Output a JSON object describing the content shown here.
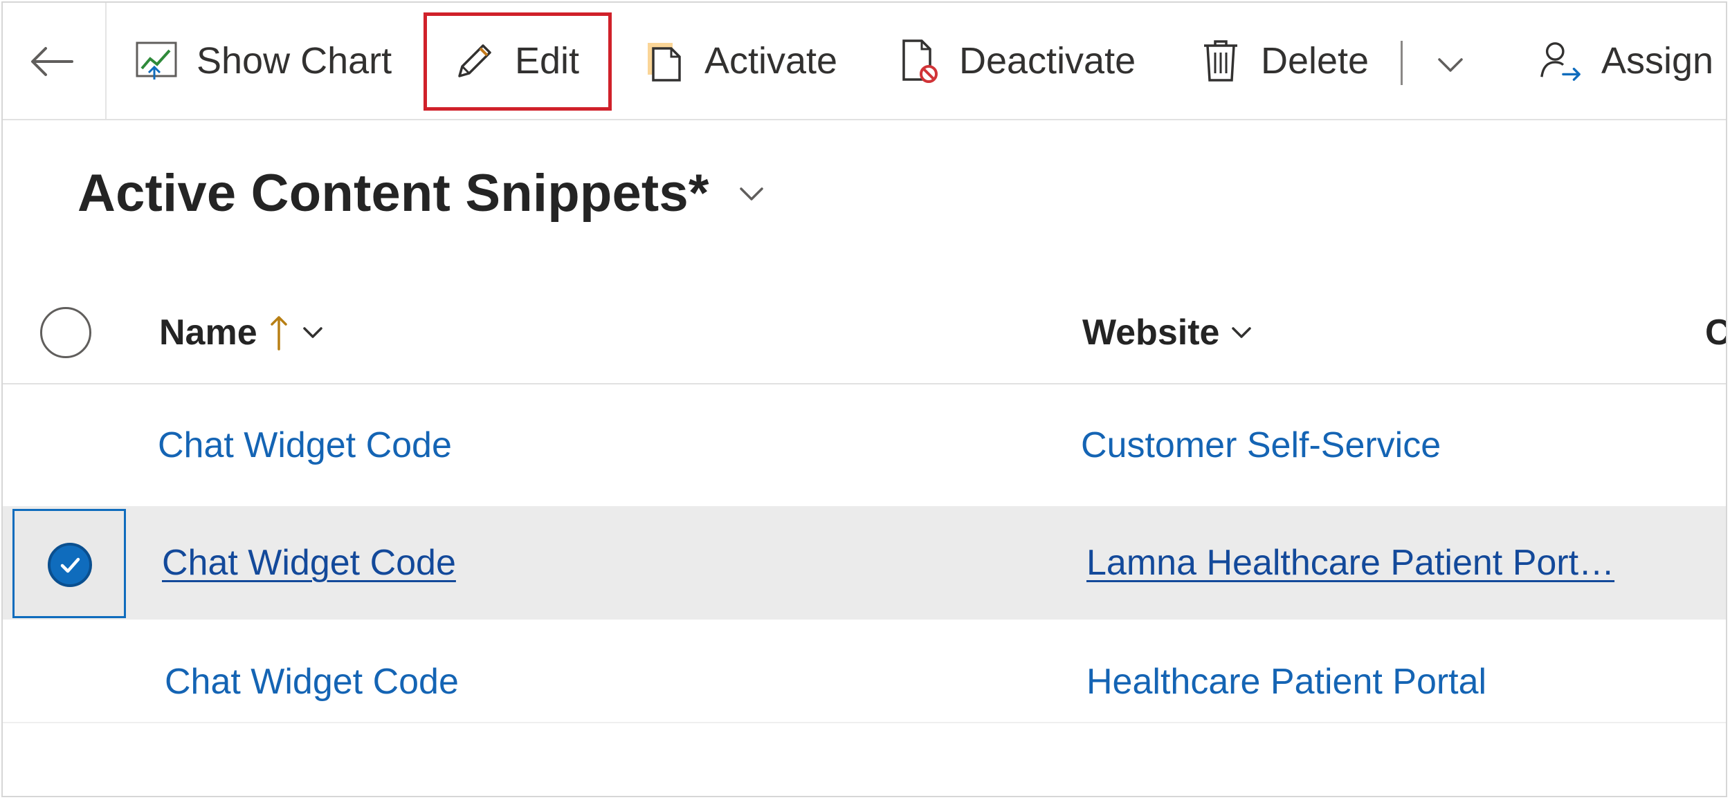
{
  "toolbar": {
    "show_chart": "Show Chart",
    "edit": "Edit",
    "activate": "Activate",
    "deactivate": "Deactivate",
    "delete": "Delete",
    "assign": "Assign",
    "icons": [
      "back-arrow-icon",
      "chart-icon",
      "pencil-icon",
      "activate-icon",
      "deactivate-icon",
      "trash-icon",
      "chevron-down-icon",
      "assign-user-icon"
    ]
  },
  "view": {
    "title": "Active Content Snippets*"
  },
  "grid": {
    "columns": [
      {
        "label": "Name",
        "sort": "ascending"
      },
      {
        "label": "Website"
      },
      {
        "label": "C"
      }
    ],
    "rows": [
      {
        "name": "Chat Widget Code",
        "website": "Customer Self-Service",
        "selected": false
      },
      {
        "name": "Chat Widget Code",
        "website": "Lamna Healthcare Patient Port…",
        "selected": true
      },
      {
        "name": "Chat Widget Code",
        "website": "Healthcare Patient Portal",
        "selected": false
      }
    ]
  },
  "colors": {
    "link": "#1464b4",
    "accent": "#0f6cbd",
    "highlight": "#d0212a",
    "selected_row": "#ebebeb"
  }
}
